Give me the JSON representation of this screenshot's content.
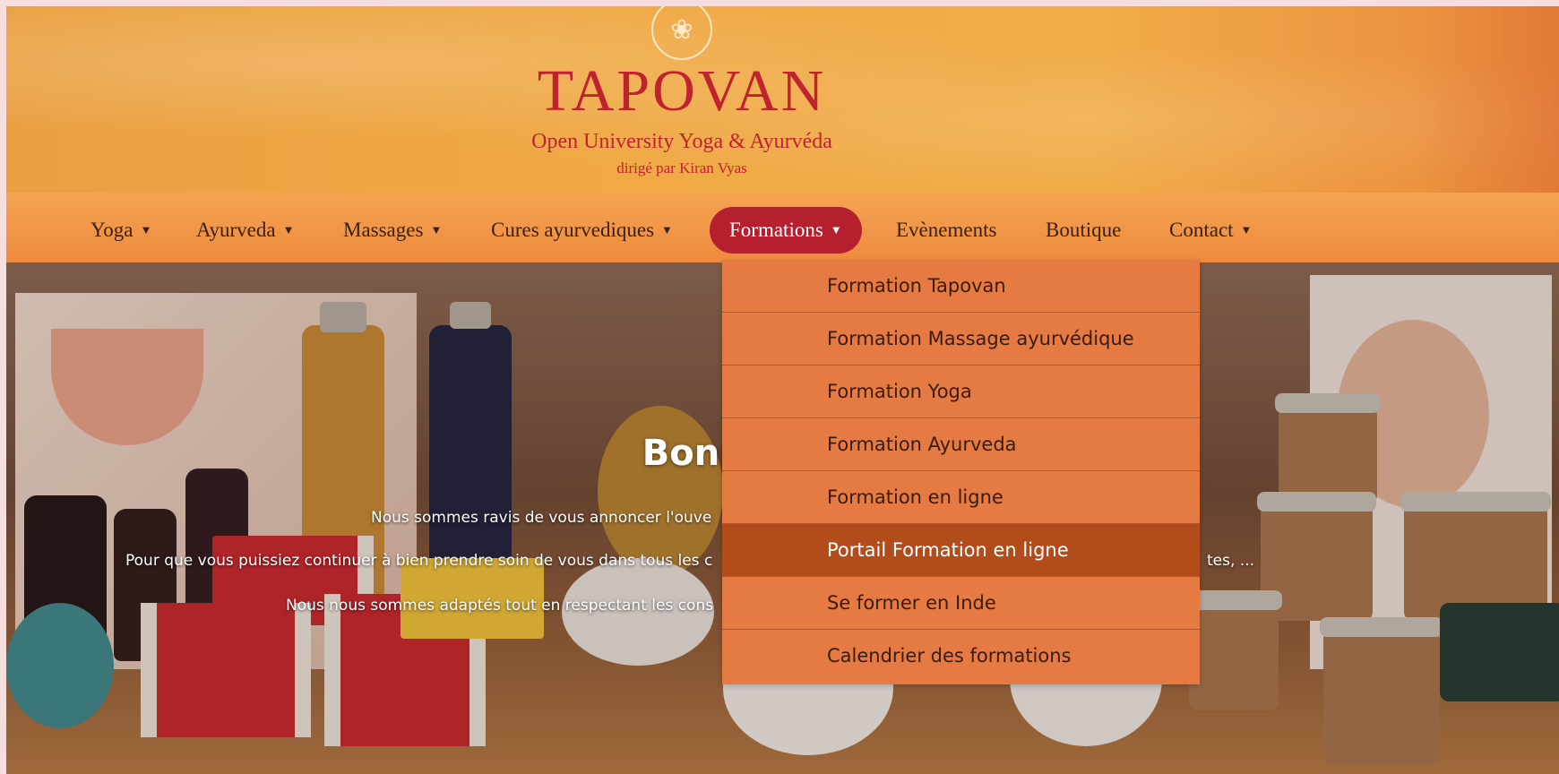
{
  "brand": {
    "logo_glyph": "❀",
    "title": "TAPOVAN",
    "subtitle": "Open University Yoga & Ayurvéda",
    "tagline": "dirigé par Kiran Vyas"
  },
  "nav": {
    "items": [
      {
        "label": "Yoga",
        "caret": "▼"
      },
      {
        "label": "Ayurveda",
        "caret": "▼"
      },
      {
        "label": "Massages",
        "caret": "▼"
      },
      {
        "label": "Cures ayurvediques",
        "caret": "▼"
      },
      {
        "label": "Formations",
        "caret": "▼"
      },
      {
        "label": "Evènements"
      },
      {
        "label": "Boutique"
      },
      {
        "label": "Contact",
        "caret": "▼"
      }
    ],
    "active": "Formations"
  },
  "dropdown": {
    "items": [
      "Formation Tapovan",
      "Formation Massage ayurvédique",
      "Formation Yoga",
      "Formation Ayurveda",
      "Formation en ligne",
      "Portail Formation en ligne",
      "Se former en Inde",
      "Calendrier des formations"
    ],
    "highlighted": "Portail Formation en ligne"
  },
  "hero": {
    "title": "Bonne nou",
    "line1": "Nous sommes ravis de vous annoncer l'ouve",
    "line2a": "Pour que vous puissiez continuer à bien prendre soin de vous dans tous les c",
    "line2b": "tes, ...",
    "line3": "Nous nous sommes adaptés tout en respectant les cons"
  },
  "colors": {
    "brand_red": "#c0232e",
    "nav_active": "#b4202d",
    "dropdown_bg": "#e57a42",
    "dropdown_highlight": "#b24c1a"
  }
}
